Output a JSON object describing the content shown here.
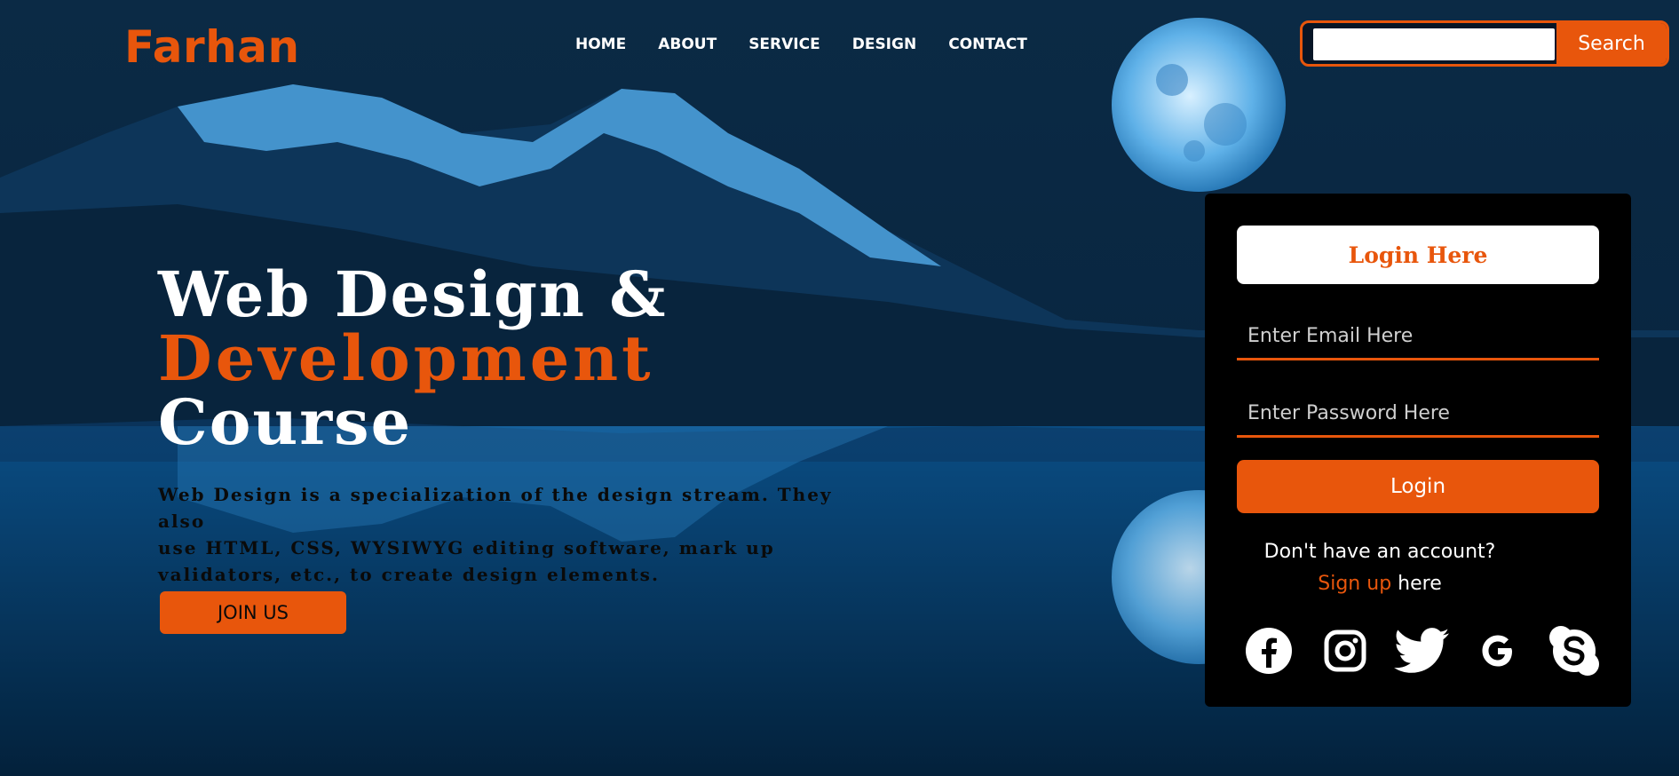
{
  "brand": {
    "logo": "Farhan"
  },
  "nav": {
    "items": [
      "HOME",
      "ABOUT",
      "SERVICE",
      "DESIGN",
      "CONTACT"
    ]
  },
  "search": {
    "value": "",
    "button_label": "Search"
  },
  "hero": {
    "title_line1": "Web Design &",
    "title_line2": "Development",
    "title_line3": "Course",
    "description_line1": "Web Design is a specialization of the design stream. They also",
    "description_line2": "use HTML, CSS, WYSIWYG editing software, mark up",
    "description_line3": "validators, etc., to create design elements.",
    "cta_label": "JOIN US"
  },
  "login": {
    "title": "Login Here",
    "email_placeholder": "Enter Email Here",
    "password_placeholder": "Enter Password Here",
    "button_label": "Login",
    "no_account_text": "Don't have an account?",
    "signup_link": "Sign up",
    "signup_suffix": "here"
  },
  "socials": [
    "facebook-icon",
    "instagram-icon",
    "twitter-icon",
    "google-icon",
    "skype-icon"
  ],
  "colors": {
    "accent": "#e8560c",
    "panel": "#000000",
    "text": "#ffffff"
  }
}
